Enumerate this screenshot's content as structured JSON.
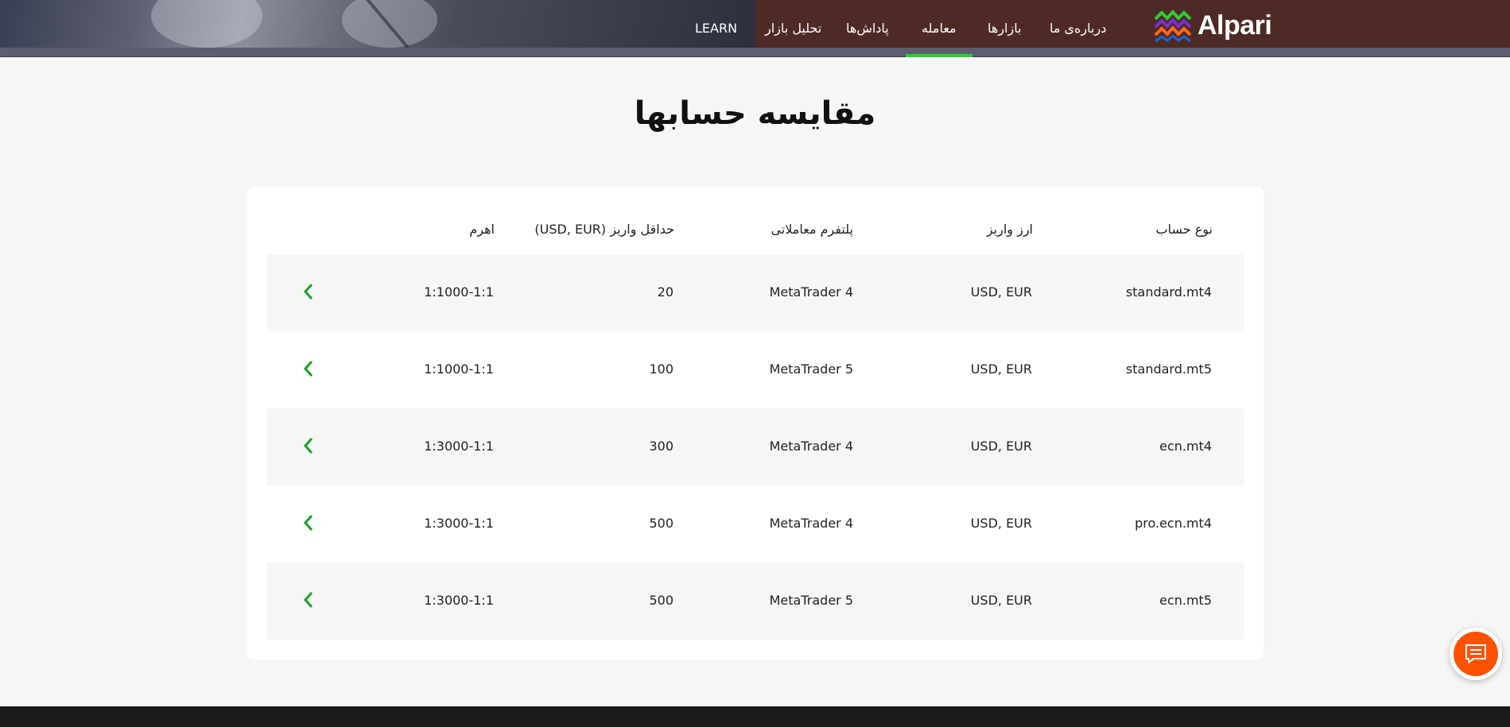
{
  "header": {
    "logo_text": "Alpari",
    "nav": [
      {
        "label": "درباره‌ی ما"
      },
      {
        "label": "بازارها"
      },
      {
        "label": "معامله",
        "active": true
      },
      {
        "label": "پاداش‌ها"
      },
      {
        "label": "تحلیل بازار"
      },
      {
        "label": "LEARN"
      }
    ]
  },
  "page": {
    "title": "مقایسه حسابها"
  },
  "table": {
    "columns": {
      "account_type": "نوع حساب",
      "deposit_currency": "ارز واریز",
      "platform": "پلتفرم معاملاتی",
      "min_deposit": "حداقل واریز (USD, EUR)",
      "leverage": "اهرم"
    },
    "rows": [
      {
        "account_type": "standard.mt4",
        "deposit_currency": "USD, EUR",
        "platform": "MetaTrader 4",
        "min_deposit": "20",
        "leverage": "1:1000-1:1"
      },
      {
        "account_type": "standard.mt5",
        "deposit_currency": "USD, EUR",
        "platform": "MetaTrader 5",
        "min_deposit": "100",
        "leverage": "1:1000-1:1"
      },
      {
        "account_type": "ecn.mt4",
        "deposit_currency": "USD, EUR",
        "platform": "MetaTrader 4",
        "min_deposit": "300",
        "leverage": "1:3000-1:1"
      },
      {
        "account_type": "pro.ecn.mt4",
        "deposit_currency": "USD, EUR",
        "platform": "MetaTrader 4",
        "min_deposit": "500",
        "leverage": "1:3000-1:1"
      },
      {
        "account_type": "ecn.mt5",
        "deposit_currency": "USD, EUR",
        "platform": "MetaTrader 5",
        "min_deposit": "500",
        "leverage": "1:3000-1:1"
      }
    ]
  },
  "colors": {
    "nav_bg": "#4e2a26",
    "accent_green": "#32cd32",
    "chevron_green": "#1aa323",
    "chat_orange": "#ff5200"
  },
  "icons": {
    "row_action": "chevron-left-icon",
    "chat": "chat-icon"
  }
}
